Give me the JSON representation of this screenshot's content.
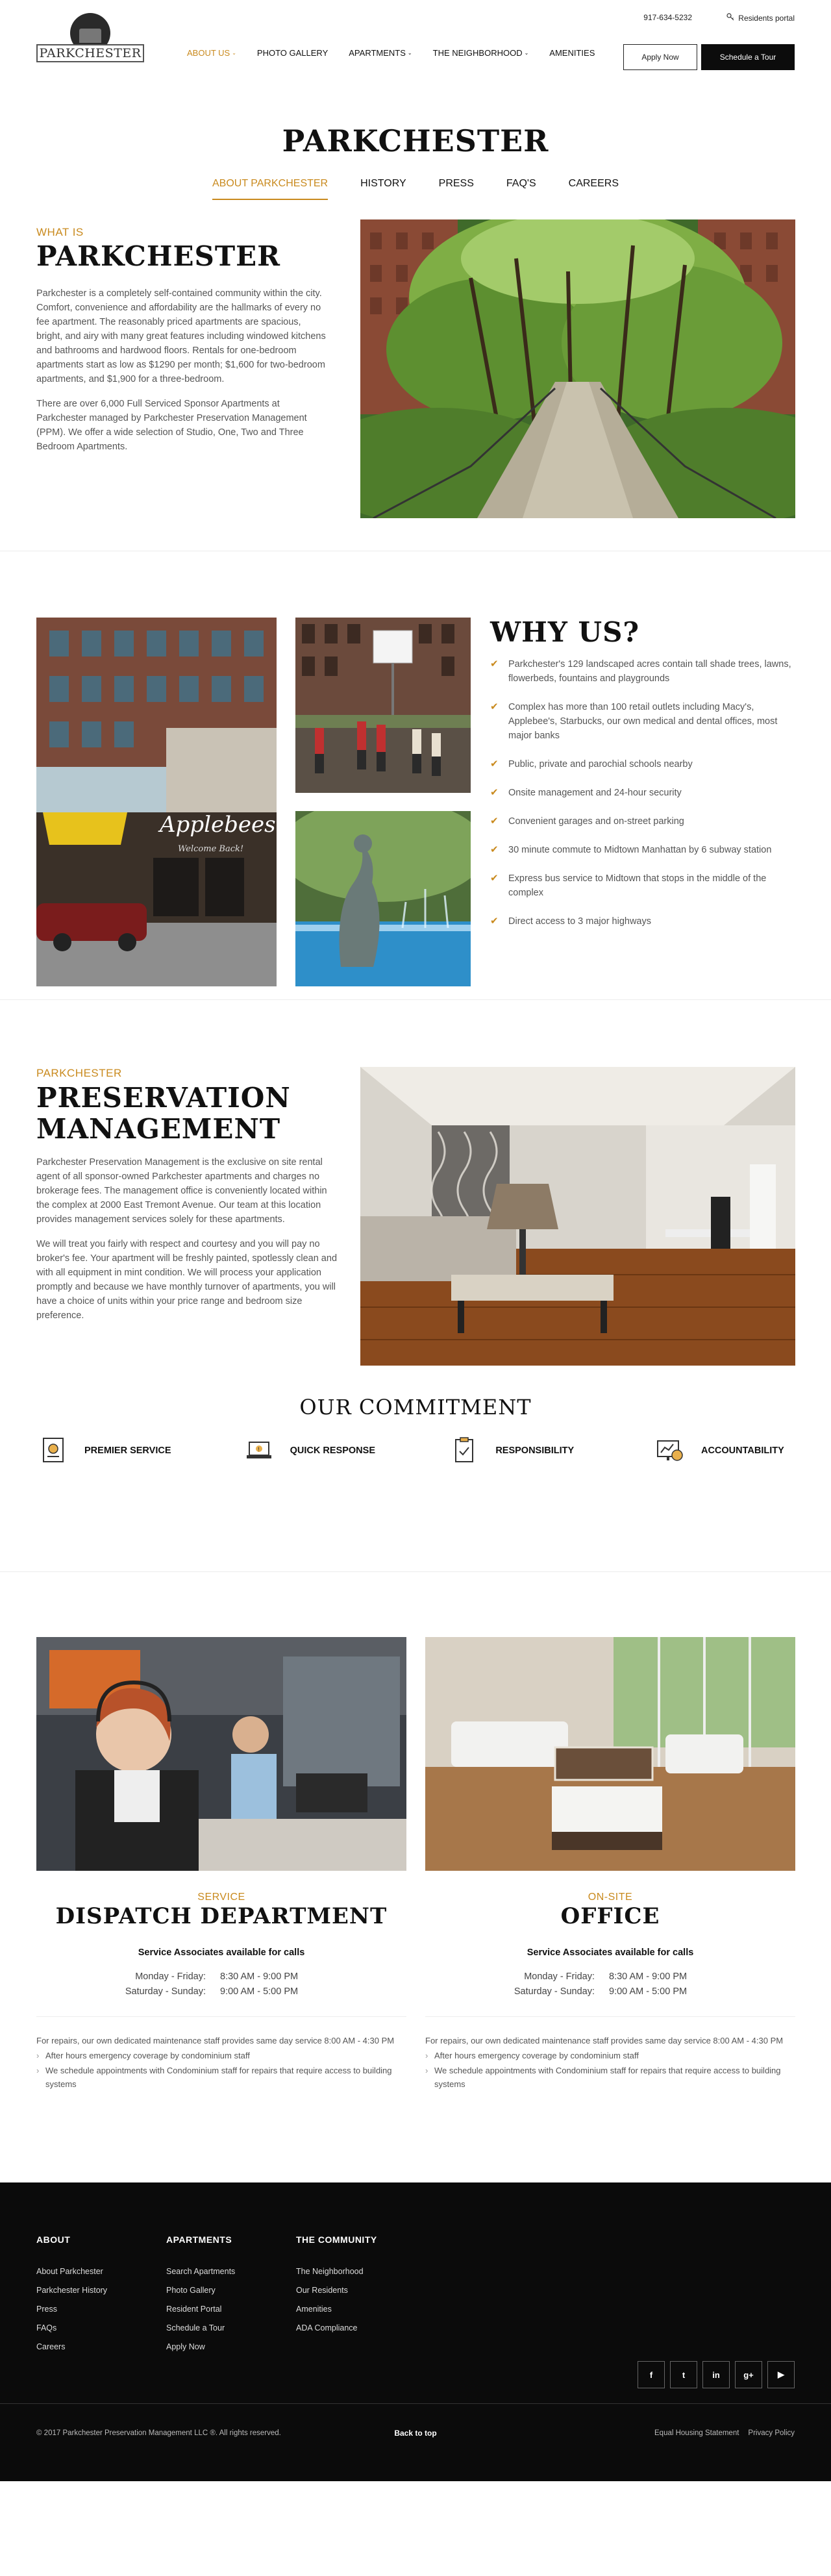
{
  "header": {
    "phone": "917-634-5232",
    "portal_label": "Residents portal",
    "logo_text": "PARKCHESTER",
    "nav": [
      {
        "label": "ABOUT US",
        "dropdown": true,
        "active": true
      },
      {
        "label": "PHOTO GALLERY",
        "dropdown": false,
        "active": false
      },
      {
        "label": "APARTMENTS",
        "dropdown": true,
        "active": false
      },
      {
        "label": "THE NEIGHBORHOOD",
        "dropdown": true,
        "active": false
      },
      {
        "label": "AMENITIES",
        "dropdown": false,
        "active": false
      }
    ],
    "apply_label": "Apply Now",
    "tour_label": "Schedule a Tour"
  },
  "page_title": "PARKCHESTER",
  "subnav": [
    {
      "label": "ABOUT PARKCHESTER",
      "active": true
    },
    {
      "label": "HISTORY",
      "active": false
    },
    {
      "label": "PRESS",
      "active": false
    },
    {
      "label": "FAQ'S",
      "active": false
    },
    {
      "label": "CAREERS",
      "active": false
    }
  ],
  "about": {
    "kicker": "WHAT IS",
    "title": "PARKCHESTER",
    "p1": "Parkchester is a completely self-contained community within the city. Comfort, convenience and affordability are the hallmarks of every no fee apartment. The reasonably priced apartments are spacious, bright, and airy with many great features including windowed kitchens and bathrooms and hardwood floors. Rentals for one-bedroom apartments start as low as $1290 per month; $1,600 for two-bedroom apartments, and $1,900 for a three-bedroom.",
    "p2": "There are over 6,000 Full Serviced Sponsor Apartments at Parkchester managed by Parkchester Preservation Management (PPM). We offer a wide selection of Studio, One, Two and Three Bedroom Apartments."
  },
  "why": {
    "title": "WHY US?",
    "items": [
      "Parkchester's 129 landscaped acres contain tall shade trees, lawns, flowerbeds, fountains and playgrounds",
      "Complex has more than 100 retail outlets including Macy's, Applebee's, Starbucks, our own medical and dental offices, most major banks",
      "Public, private and parochial schools nearby",
      "Onsite management and 24-hour security",
      "Convenient garages and on-street parking",
      "30 minute commute to Midtown Manhattan by 6 subway station",
      "Express bus service to Midtown that stops in the middle of the complex",
      "Direct access to 3 major highways"
    ],
    "sign_text": "Applebees",
    "sign_sub": "Welcome Back!"
  },
  "mgmt": {
    "kicker": "PARKCHESTER",
    "title_line1": "PRESERVATION",
    "title_line2": "MANAGEMENT",
    "p1": "Parkchester Preservation Management is the exclusive on site rental agent of all sponsor-owned Parkchester apartments and charges no brokerage fees. The management office is conveniently located within the complex at 2000 East Tremont Avenue. Our team at this location provides management services solely for these apartments.",
    "p2": "We will treat you fairly with respect and courtesy and you will pay no broker's fee. Your apartment will be freshly painted, spotlessly clean and with all equipment in mint condition. We will process your application promptly and because we have monthly turnover of apartments, you will have a choice of units within your price range and bedroom size preference."
  },
  "commitment": {
    "title": "OUR COMMITMENT",
    "items": [
      {
        "label": "PREMIER SERVICE",
        "icon": "certificate-icon"
      },
      {
        "label": "QUICK RESPONSE",
        "icon": "laptop-alert-icon"
      },
      {
        "label": "RESPONSIBILITY",
        "icon": "clipboard-check-icon"
      },
      {
        "label": "ACCOUNTABILITY",
        "icon": "monitor-chart-icon"
      }
    ]
  },
  "service": [
    {
      "kicker": "SERVICE",
      "title": "DISPATCH DEPARTMENT",
      "avail": "Service Associates available for calls",
      "hours": [
        {
          "days": "Monday - Friday:",
          "time": "8:30 AM - 9:00 PM"
        },
        {
          "days": "Saturday - Sunday:",
          "time": "9:00 AM - 5:00 PM"
        }
      ],
      "repair": "For repairs, our own dedicated maintenance staff provides same day service 8:00 AM - 4:30 PM",
      "bullets": [
        "After hours emergency coverage by condominium staff",
        "We schedule appointments with Condominium staff for repairs that require access to building systems"
      ]
    },
    {
      "kicker": "ON-SITE",
      "title": "OFFICE",
      "avail": "Service Associates available for calls",
      "hours": [
        {
          "days": "Monday - Friday:",
          "time": "8:30 AM - 9:00 PM"
        },
        {
          "days": "Saturday - Sunday:",
          "time": "9:00 AM - 5:00 PM"
        }
      ],
      "repair": "For repairs, our own dedicated maintenance staff provides same day service 8:00 AM - 4:30 PM",
      "bullets": [
        "After hours emergency coverage by condominium staff",
        "We schedule appointments with Condominium staff for repairs that require access to building systems"
      ]
    }
  ],
  "footer": {
    "cols": [
      {
        "title": "ABOUT",
        "links": [
          "About Parkchester",
          "Parkchester History",
          "Press",
          "FAQs",
          "Careers"
        ]
      },
      {
        "title": "APARTMENTS",
        "links": [
          "Search Apartments",
          "Photo Gallery",
          "Resident Portal",
          "Schedule a Tour",
          "Apply Now"
        ]
      },
      {
        "title": "THE COMMUNITY",
        "links": [
          "The Neighborhood",
          "Our Residents",
          "Amenities",
          "ADA Compliance"
        ]
      }
    ],
    "social": [
      {
        "glyph": "f",
        "icon": "facebook-icon"
      },
      {
        "glyph": "t",
        "icon": "twitter-icon"
      },
      {
        "glyph": "in",
        "icon": "linkedin-icon"
      },
      {
        "glyph": "g+",
        "icon": "google-plus-icon"
      },
      {
        "glyph": "▶",
        "icon": "youtube-icon"
      }
    ],
    "copyright": "© 2017 Parkchester Preservation Management LLC ®. All rights reserved.",
    "back_to_top": "Back to top",
    "legal": [
      "Equal Housing Statement",
      "Privacy Policy"
    ]
  },
  "colors": {
    "accent": "#c98a1e",
    "dark": "#0b0b0b"
  }
}
